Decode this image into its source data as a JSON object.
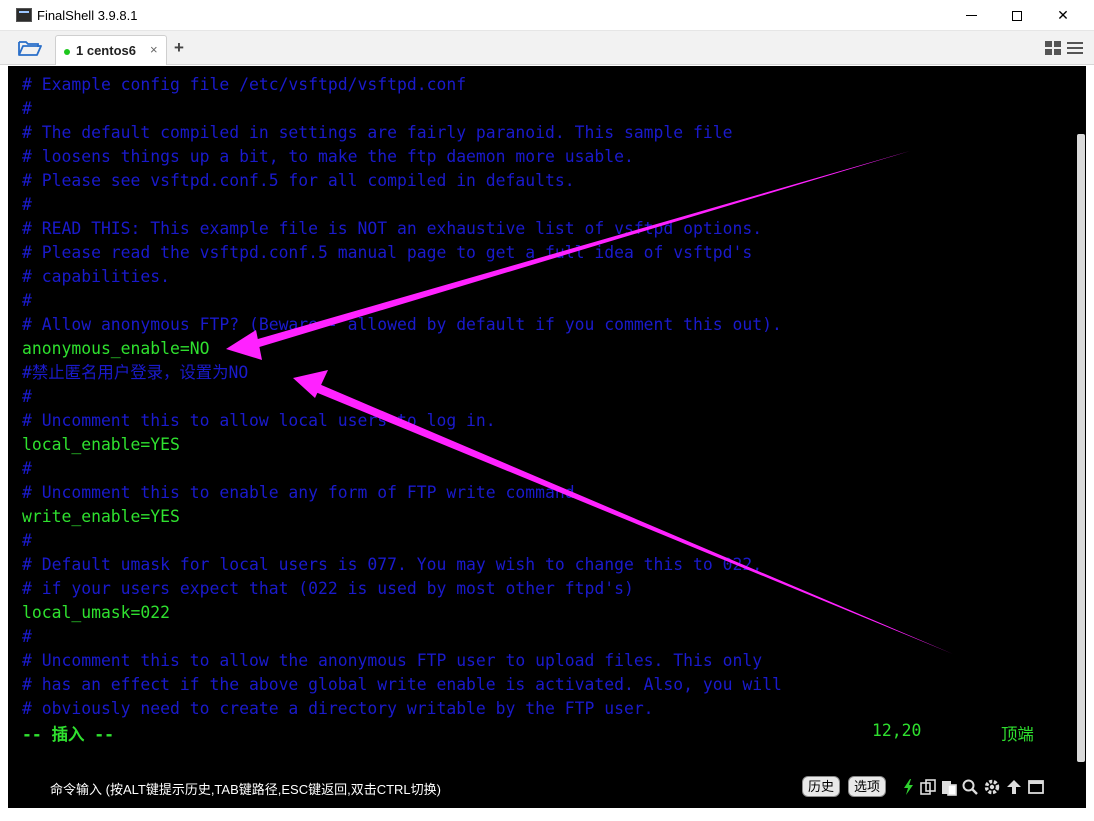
{
  "window": {
    "title": "FinalShell 3.9.8.1",
    "minimize_icon": "minimize-icon",
    "maximize_icon": "maximize-icon",
    "close_label": "✕"
  },
  "tabs": {
    "items": [
      {
        "label": "1 centos6",
        "close": "×",
        "status_color": "#1ec81e"
      }
    ],
    "add_label": "+"
  },
  "terminal": {
    "lines": [
      {
        "text": "# Example config file /etc/vsftpd/vsftpd.conf",
        "kind": "comment"
      },
      {
        "text": "#",
        "kind": "comment"
      },
      {
        "text": "# The default compiled in settings are fairly paranoid. This sample file",
        "kind": "comment"
      },
      {
        "text": "# loosens things up a bit, to make the ftp daemon more usable.",
        "kind": "comment"
      },
      {
        "text": "# Please see vsftpd.conf.5 for all compiled in defaults.",
        "kind": "comment"
      },
      {
        "text": "#",
        "kind": "comment"
      },
      {
        "text": "# READ THIS: This example file is NOT an exhaustive list of vsftpd options.",
        "kind": "comment"
      },
      {
        "text": "# Please read the vsftpd.conf.5 manual page to get a full idea of vsftpd's",
        "kind": "comment"
      },
      {
        "text": "# capabilities.",
        "kind": "comment"
      },
      {
        "text": "#",
        "kind": "comment"
      },
      {
        "text": "# Allow anonymous FTP? (Beware - allowed by default if you comment this out).",
        "kind": "comment"
      },
      {
        "text": "anonymous_enable=NO",
        "kind": "setting"
      },
      {
        "text": "#禁止匿名用户登录，设置为NO",
        "kind": "comment"
      },
      {
        "text": "#",
        "kind": "comment"
      },
      {
        "text": "# Uncomment this to allow local users to log in.",
        "kind": "comment"
      },
      {
        "text": "local_enable=YES",
        "kind": "setting"
      },
      {
        "text": "#",
        "kind": "comment"
      },
      {
        "text": "# Uncomment this to enable any form of FTP write command.",
        "kind": "comment"
      },
      {
        "text": "write_enable=YES",
        "kind": "setting"
      },
      {
        "text": "#",
        "kind": "comment"
      },
      {
        "text": "# Default umask for local users is 077. You may wish to change this to 022,",
        "kind": "comment"
      },
      {
        "text": "# if your users expect that (022 is used by most other ftpd's)",
        "kind": "comment"
      },
      {
        "text": "local_umask=022",
        "kind": "setting"
      },
      {
        "text": "#",
        "kind": "comment"
      },
      {
        "text": "# Uncomment this to allow the anonymous FTP user to upload files. This only",
        "kind": "comment"
      },
      {
        "text": "# has an effect if the above global write enable is activated. Also, you will",
        "kind": "comment"
      },
      {
        "text": "# obviously need to create a directory writable by the FTP user.",
        "kind": "comment"
      }
    ],
    "status": {
      "mode": "-- 插入 --",
      "position": "12,20",
      "scroll": "顶端"
    },
    "colors": {
      "background": "#000000",
      "comment": "#1a1acc",
      "setting": "#2fe02f",
      "annotation_arrow": "#ff22ff"
    }
  },
  "command_bar": {
    "hint": "命令输入 (按ALT键提示历史,TAB键路径,ESC键返回,双击CTRL切换)",
    "history_label": "历史",
    "options_label": "选项",
    "tools": [
      "lightning-icon",
      "copy-icon",
      "paste-icon",
      "search-icon",
      "gear-icon",
      "up-arrow-icon",
      "window-icon"
    ]
  }
}
